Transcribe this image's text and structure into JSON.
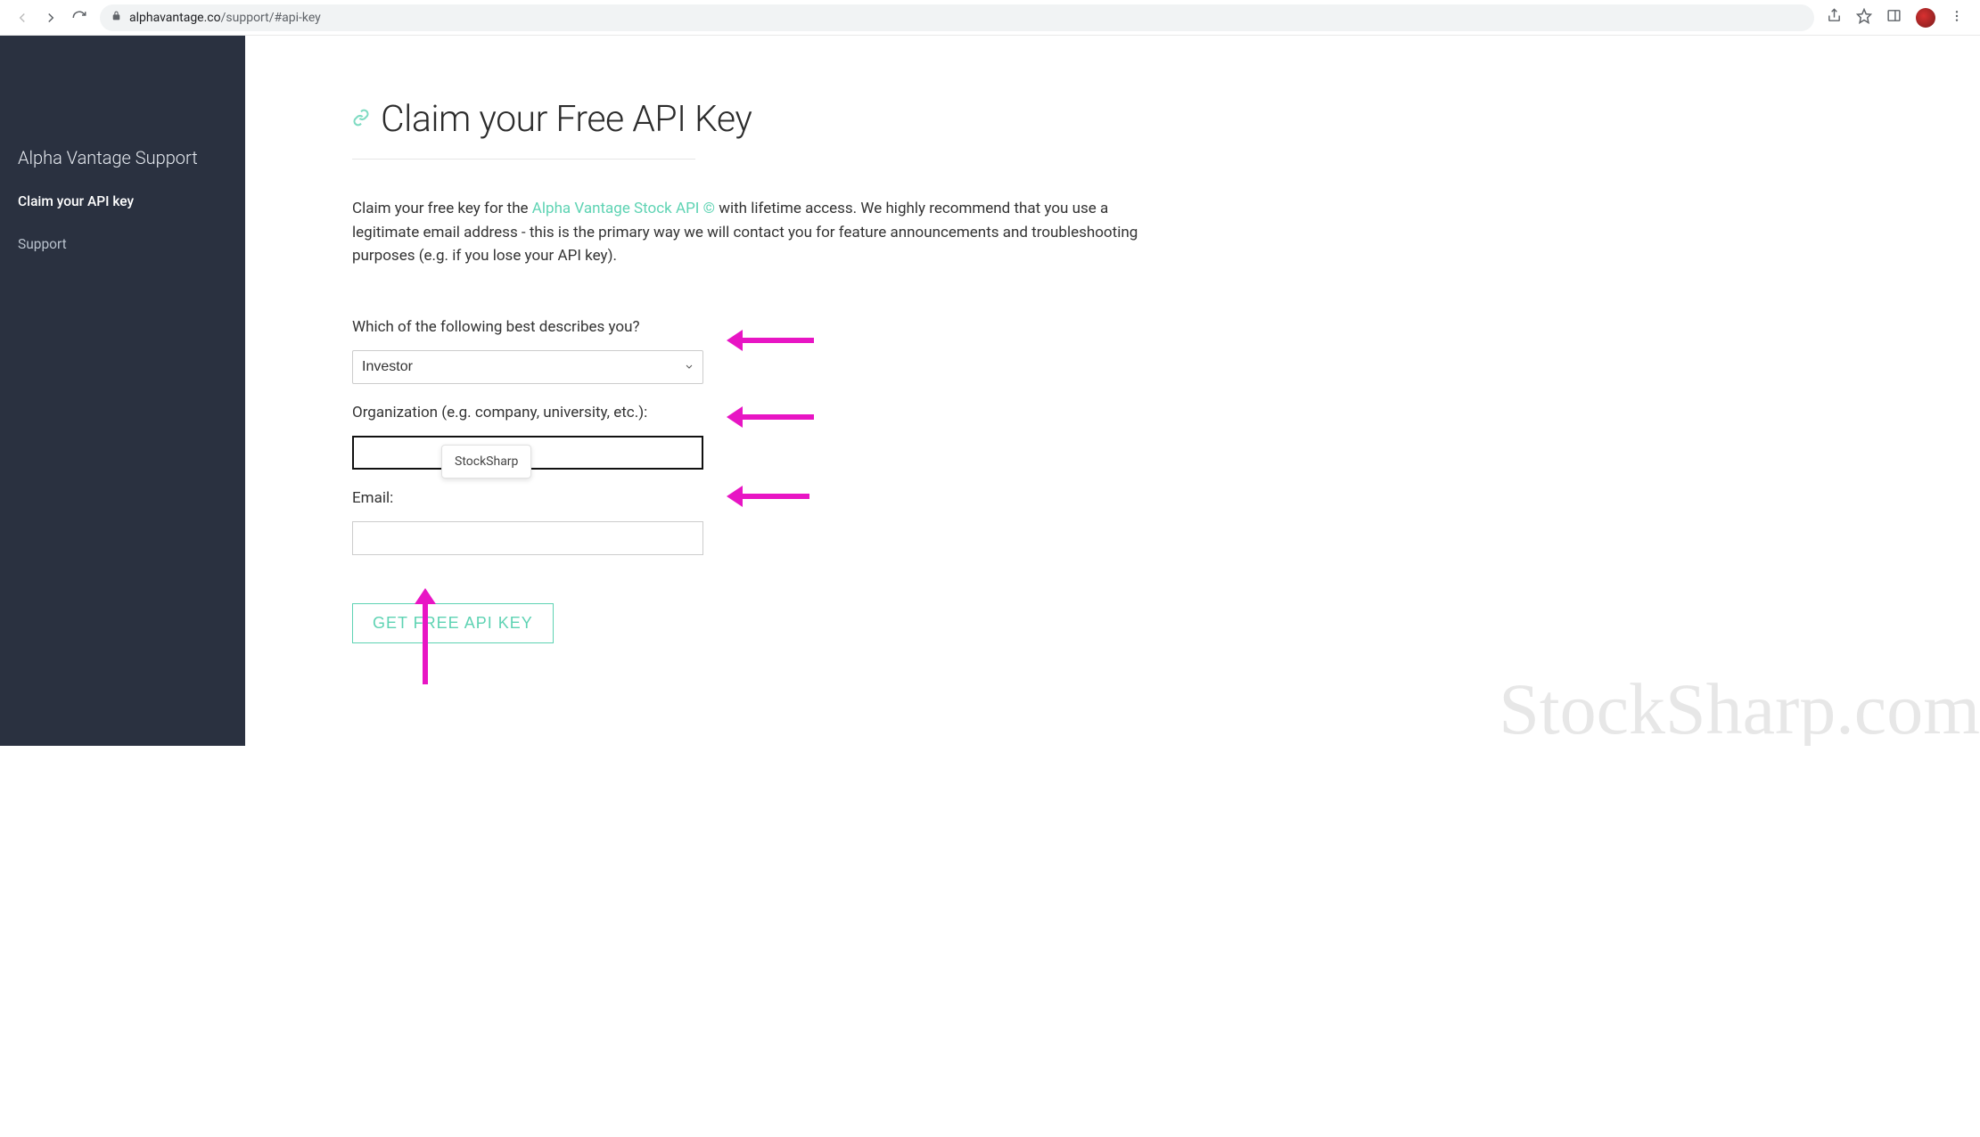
{
  "chrome": {
    "url_host": "alphavantage.co",
    "url_path": "/support/#api-key"
  },
  "sidebar": {
    "title": "Alpha Vantage Support",
    "items": [
      {
        "label": "Claim your API key",
        "active": true
      },
      {
        "label": "Support",
        "active": false
      }
    ]
  },
  "page": {
    "heading": "Claim your Free API Key",
    "intro_pre": "Claim your free key for the ",
    "intro_link": "Alpha Vantage Stock API ©",
    "intro_post": " with lifetime access. We highly recommend that you use a legitimate email address - this is the primary way we will contact you for feature announcements and troubleshooting purposes (e.g. if you lose your API key)."
  },
  "form": {
    "role_label": "Which of the following best describes you?",
    "role_value": "Investor",
    "org_label": "Organization (e.g. company, university, etc.):",
    "org_value": "",
    "email_label": "Email:",
    "email_value": "",
    "tooltip": "StockSharp",
    "submit": "GET FREE API KEY"
  },
  "watermark": "StockSharp.com"
}
